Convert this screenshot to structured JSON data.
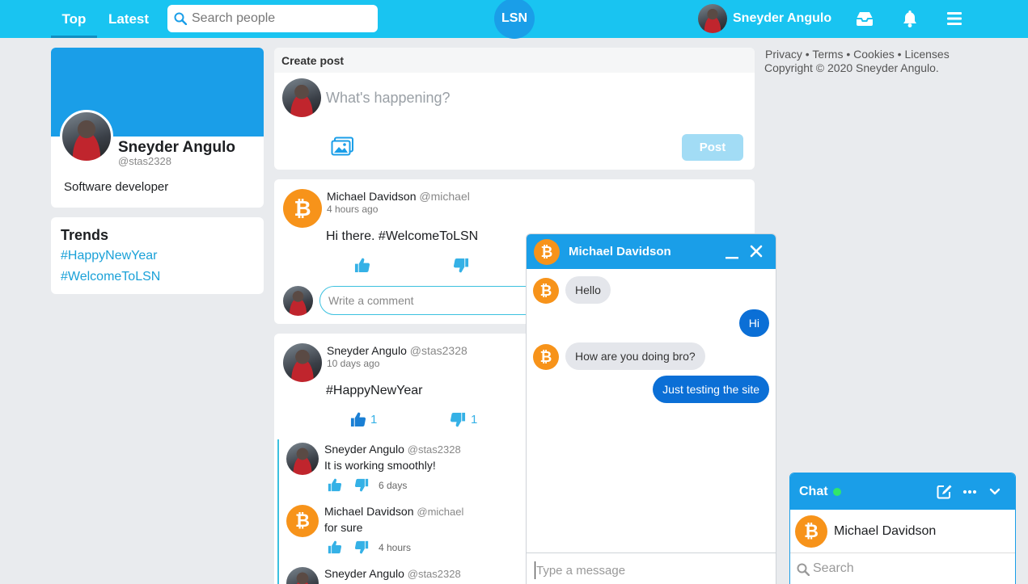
{
  "nav": {
    "tabs": [
      {
        "label": "Top"
      },
      {
        "label": "Latest"
      }
    ],
    "search_placeholder": "Search people",
    "logo": "LSN",
    "user_name": "Sneyder Angulo",
    "icons": [
      "inbox-icon",
      "bell-icon",
      "menu-icon"
    ]
  },
  "profile": {
    "name": "Sneyder Angulo",
    "handle": "@stas2328",
    "bio": "Software developer"
  },
  "trends": {
    "title": "Trends",
    "items": [
      "#HappyNewYear",
      "#WelcomeToLSN"
    ]
  },
  "create_post": {
    "header": "Create post",
    "placeholder": "What's happening?",
    "post_label": "Post"
  },
  "posts": [
    {
      "author": "Michael Davidson",
      "handle": "@michael",
      "time": "4 hours ago",
      "text": "Hi there. #WelcomeToLSN",
      "comment_placeholder": "Write a comment"
    },
    {
      "author": "Sneyder Angulo",
      "handle": "@stas2328",
      "time": "10 days ago",
      "text": "#HappyNewYear",
      "likes": "1",
      "dislikes": "1",
      "comments": [
        {
          "author": "Sneyder Angulo",
          "handle": "@stas2328",
          "text": "It is working smoothly!",
          "time": "6 days"
        },
        {
          "author": "Michael Davidson",
          "handle": "@michael",
          "text": "for sure",
          "time": "4 hours"
        },
        {
          "author": "Sneyder Angulo",
          "handle": "@stas2328",
          "text": "",
          "time": ""
        }
      ]
    }
  ],
  "footer": {
    "links": [
      "Privacy",
      "Terms",
      "Cookies",
      "Licenses"
    ],
    "separator": "•",
    "copyright": "Copyright © 2020 Sneyder Angulo."
  },
  "chat_window": {
    "title": "Michael Davidson",
    "messages": [
      {
        "dir": "in",
        "text": "Hello"
      },
      {
        "dir": "out",
        "text": "Hi"
      },
      {
        "dir": "in",
        "text": "How are you doing bro?"
      },
      {
        "dir": "out",
        "text": "Just testing the site"
      }
    ],
    "input_placeholder": "Type a message"
  },
  "chat_panel": {
    "title": "Chat",
    "contacts": [
      {
        "name": "Michael Davidson"
      }
    ],
    "search_placeholder": "Search"
  },
  "colors": {
    "topbar": "#19c4f1",
    "brand": "#1a9ee8",
    "link": "#1aa1d8",
    "outgoing_bubble": "#0b6fd6",
    "bitcoin": "#f7931a",
    "online": "#31e66b"
  }
}
